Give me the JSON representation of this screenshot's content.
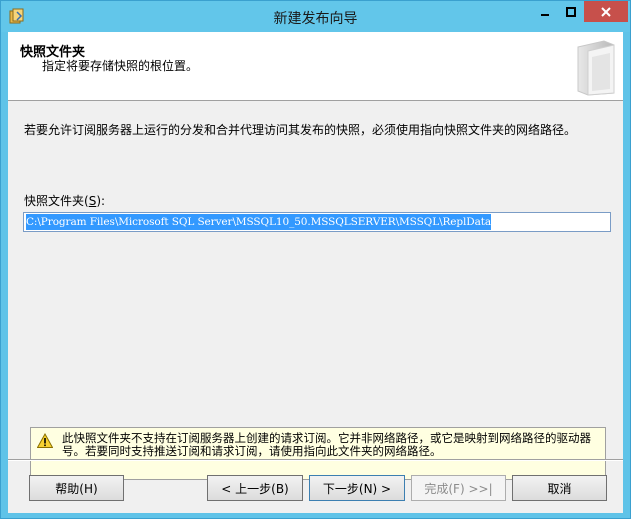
{
  "window": {
    "title": "新建发布向导"
  },
  "header": {
    "title": "快照文件夹",
    "subtitle": "指定将要存储快照的根位置。"
  },
  "content": {
    "intro": "若要允许订阅服务器上运行的分发和合并代理访问其发布的快照，必须使用指向快照文件夹的网络路径。",
    "folder_label_prefix": "快照文件夹(",
    "folder_label_key": "S",
    "folder_label_suffix": "):",
    "folder_value": "C:\\Program Files\\Microsoft SQL Server\\MSSQL10_50.MSSQLSERVER\\MSSQL\\ReplData"
  },
  "warning": {
    "icon": "warning-icon",
    "text": "此快照文件夹不支持在订阅服务器上创建的请求订阅。它并非网络路径，或它是映射到网络路径的驱动器号。若要同时支持推送订阅和请求订阅，请使用指向此文件夹的网络路径。"
  },
  "buttons": {
    "help": "帮助(H)",
    "back": "< 上一步(B)",
    "next": "下一步(N) >",
    "finish": "完成(F) >>|",
    "cancel": "取消"
  },
  "colors": {
    "titlebar": "#62c6ea",
    "close_button": "#c7504b",
    "selection": "#3399ff",
    "warning_bg": "#ffffe1"
  }
}
